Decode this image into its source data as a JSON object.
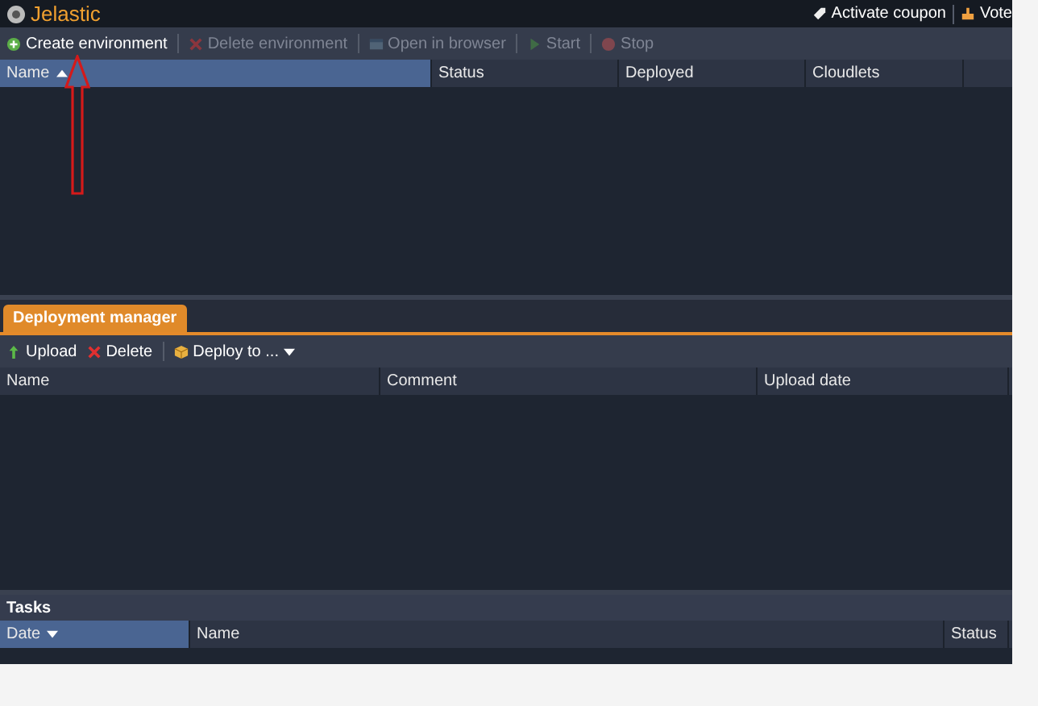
{
  "app": {
    "title": "Jelastic"
  },
  "top_links": [
    {
      "label": "Activate coupon"
    },
    {
      "label": "Vote"
    }
  ],
  "env_toolbar": [
    {
      "label": "Create environment",
      "disabled": false
    },
    {
      "label": "Delete environment",
      "disabled": true
    },
    {
      "label": "Open in browser",
      "disabled": true
    },
    {
      "label": "Start",
      "disabled": true
    },
    {
      "label": "Stop",
      "disabled": true
    }
  ],
  "env_table": {
    "columns": [
      {
        "label": "Name",
        "selected": true,
        "sort_ascending": true
      },
      {
        "label": "Status",
        "selected": false
      },
      {
        "label": "Deployed",
        "selected": false
      },
      {
        "label": "Cloudlets",
        "selected": false
      }
    ]
  },
  "deployment_tab": {
    "label": "Deployment manager",
    "selected": true
  },
  "deploy_toolbar": [
    {
      "label": "Upload",
      "disabled": false
    },
    {
      "label": "Delete",
      "disabled": false
    },
    {
      "label": "Deploy to ...",
      "disabled": false,
      "dropdown": true
    }
  ],
  "deploy_table": {
    "columns": [
      {
        "label": "Name",
        "selected": false
      },
      {
        "label": "Comment",
        "selected": false
      },
      {
        "label": "Upload date",
        "selected": false
      }
    ]
  },
  "tasks": {
    "title": "Tasks",
    "columns": [
      {
        "label": "Date",
        "selected": true,
        "sort_descending": true
      },
      {
        "label": "Name",
        "selected": false
      },
      {
        "label": "Status",
        "selected": false
      }
    ]
  },
  "annotation": {
    "kind": "arrow"
  }
}
